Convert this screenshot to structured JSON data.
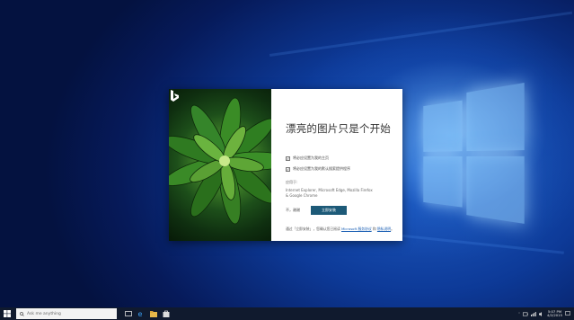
{
  "dialog": {
    "headline": "漂亮的图片只是个开始",
    "option1": "将必应设置为我的主页",
    "option2": "将必应设置为我的默认搜索提供程序",
    "applies_label": "应用于:",
    "apps_text": "Internet Explorer, Microsoft Edge, Mozilla Firefox & Google Chrome",
    "no_button": "不，谢谢",
    "ok_button": "立即安装",
    "footer_prefix": "通过「立即安装」，您确认您已阅读",
    "footer_link": "Microsoft 服务协议",
    "footer_and": "和",
    "footer_link2": "隐私说明",
    "footer_suffix": "。",
    "bing_icon": "bing-b-logo"
  },
  "taskbar": {
    "search_placeholder": "Ask me anything",
    "time": "5:07 PM",
    "date": "4/2/2015",
    "icons": [
      "windows-start-icon",
      "search-icon",
      "task-view-icon",
      "edge-icon",
      "file-explorer-icon",
      "store-icon"
    ]
  },
  "colors": {
    "desktop_blue": "#0d3a98",
    "install_button": "#1d5a78",
    "taskbar": "#101a2e"
  }
}
